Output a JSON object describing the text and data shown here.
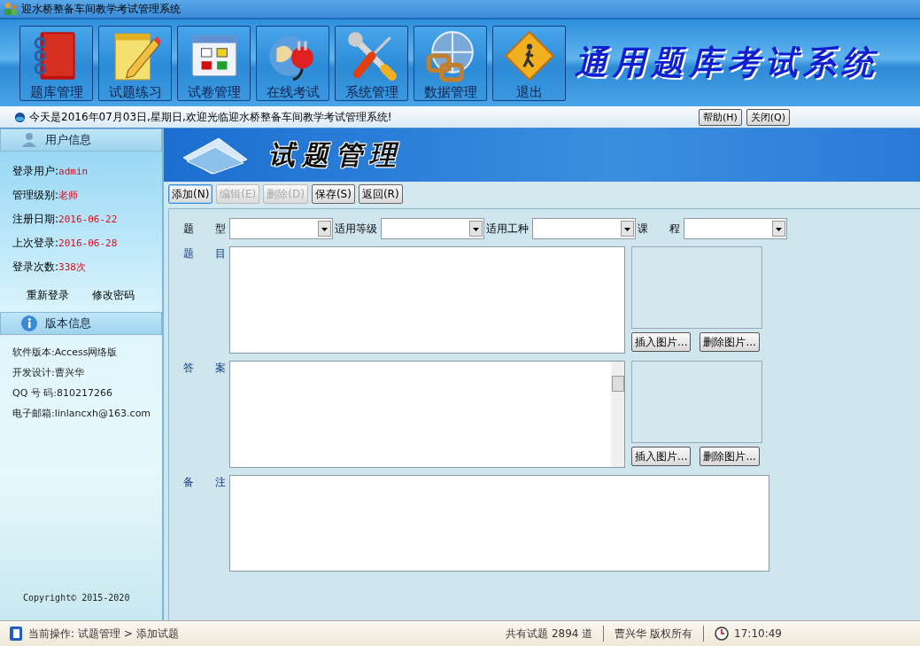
{
  "window": {
    "title": "迎水桥整备车间教学考试管理系统"
  },
  "toolbar": [
    {
      "label": "题库管理",
      "kind": "book"
    },
    {
      "label": "试题练习",
      "kind": "notepad"
    },
    {
      "label": "试卷管理",
      "kind": "window"
    },
    {
      "label": "在线考试",
      "kind": "plug"
    },
    {
      "label": "系统管理",
      "kind": "tools"
    },
    {
      "label": "数据管理",
      "kind": "network"
    },
    {
      "label": "退出",
      "kind": "exit"
    }
  ],
  "logo": "通用题库考试系统",
  "notice": {
    "text": "今天是2016年07月03日,星期日,欢迎光临迎水桥整备车间教学考试管理系统!",
    "buttons": [
      "帮助(H)",
      "关闭(Q)"
    ]
  },
  "sidebar": {
    "user_title": "用户信息",
    "user_rows": [
      {
        "label": "登录用户:",
        "value": "admin"
      },
      {
        "label": "管理级别:",
        "value": "老师"
      },
      {
        "label": "注册日期:",
        "value": "2016-06-22"
      },
      {
        "label": "上次登录:",
        "value": "2016-06-28"
      },
      {
        "label": "登录次数:",
        "value": "338次"
      }
    ],
    "user_links": [
      "重新登录",
      "修改密码"
    ],
    "version_title": "版本信息",
    "version_rows": [
      "软件版本:Access网络版",
      "开发设计:曹兴华",
      "QQ 号 码:810217266",
      "电子邮箱:linlancxh@163.com"
    ],
    "copyright": "Copyright© 2015-2020"
  },
  "page": {
    "banner": "试题管理",
    "actions": [
      {
        "label": "添加(N)",
        "disabled": false,
        "selected": true
      },
      {
        "label": "编辑(E)",
        "disabled": true,
        "selected": false
      },
      {
        "label": "删除(D)",
        "disabled": true,
        "selected": false
      },
      {
        "label": "保存(S)",
        "disabled": false,
        "selected": false
      },
      {
        "label": "返回(R)",
        "disabled": false,
        "selected": false
      }
    ],
    "combos": [
      {
        "label": "题 型"
      },
      {
        "label": "适用等级"
      },
      {
        "label": "适用工种"
      },
      {
        "label": "课 程"
      }
    ],
    "text_fields": [
      {
        "label": "题 目",
        "scrollbar": false,
        "image_buttons": [
          "插入图片...",
          "删除图片..."
        ]
      },
      {
        "label": "答 案",
        "scrollbar": true,
        "image_buttons": [
          "插入图片...",
          "删除图片..."
        ]
      }
    ],
    "remarks": {
      "label": "备 注"
    }
  },
  "status_bar": {
    "operation": "当前操作: 试题管理 > 添加试题",
    "count": "共有试题 2894 道",
    "owner": "曹兴华 版权所有",
    "time": "17:10:49"
  }
}
